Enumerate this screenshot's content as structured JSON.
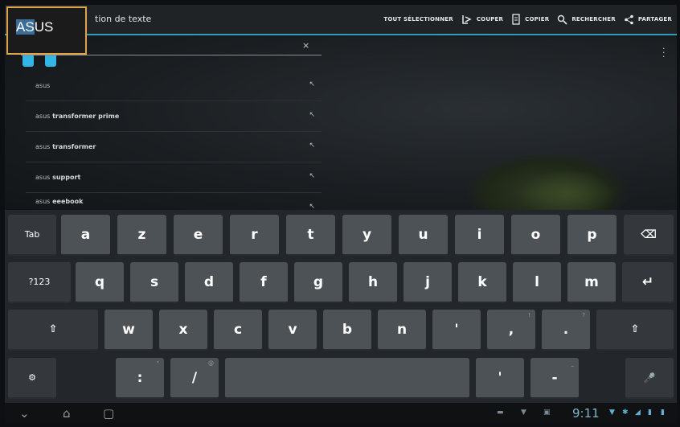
{
  "app": {
    "title": "tion de texte",
    "popup_label_selected": "AS",
    "popup_label_rest": "US"
  },
  "actions": [
    {
      "label": "TOUT SÉLECTIONNER",
      "icon": "select-all-icon"
    },
    {
      "label": "COUPER",
      "icon": "cut-icon"
    },
    {
      "label": "COPIER",
      "icon": "copy-icon"
    },
    {
      "label": "RECHERCHER",
      "icon": "search-icon"
    },
    {
      "label": "PARTAGER",
      "icon": "share-icon"
    }
  ],
  "search": {
    "clear": "×"
  },
  "suggestions": [
    {
      "prefix": "asus",
      "rest": "",
      "arrow": "↖"
    },
    {
      "prefix": "asus",
      "rest": " transformer prime",
      "arrow": "↖"
    },
    {
      "prefix": "asus",
      "rest": " transformer",
      "arrow": "↖"
    },
    {
      "prefix": "asus",
      "rest": " support",
      "arrow": "↖"
    },
    {
      "prefix": "asus",
      "rest": " eeebook",
      "arrow": "↖"
    }
  ],
  "keyboard": {
    "tab": "Tab",
    "row1": [
      "a",
      "z",
      "e",
      "r",
      "t",
      "y",
      "u",
      "i",
      "o",
      "p"
    ],
    "backspace": "⌫",
    "sym": "?123",
    "row2": [
      "q",
      "s",
      "d",
      "f",
      "g",
      "h",
      "j",
      "k",
      "l",
      "m"
    ],
    "enter": "↵",
    "shift": "⇧",
    "row3": [
      "w",
      "x",
      "c",
      "v",
      "b",
      "n",
      "'",
      ",",
      "."
    ],
    "row3_hints": [
      "",
      "",
      "",
      "",
      "",
      "",
      "",
      "!",
      "?"
    ],
    "settings": "⚙",
    "colon": ":",
    "slash": "/",
    "colon_hint": "\"",
    "slash_hint": "@",
    "space": "",
    "apostrophe": "'",
    "dash": "-",
    "dash_hint": "_",
    "mic": "🎤"
  },
  "navbar": {
    "back": "⌄",
    "home": "⌂",
    "recent": "▢",
    "clock": "9:11"
  }
}
